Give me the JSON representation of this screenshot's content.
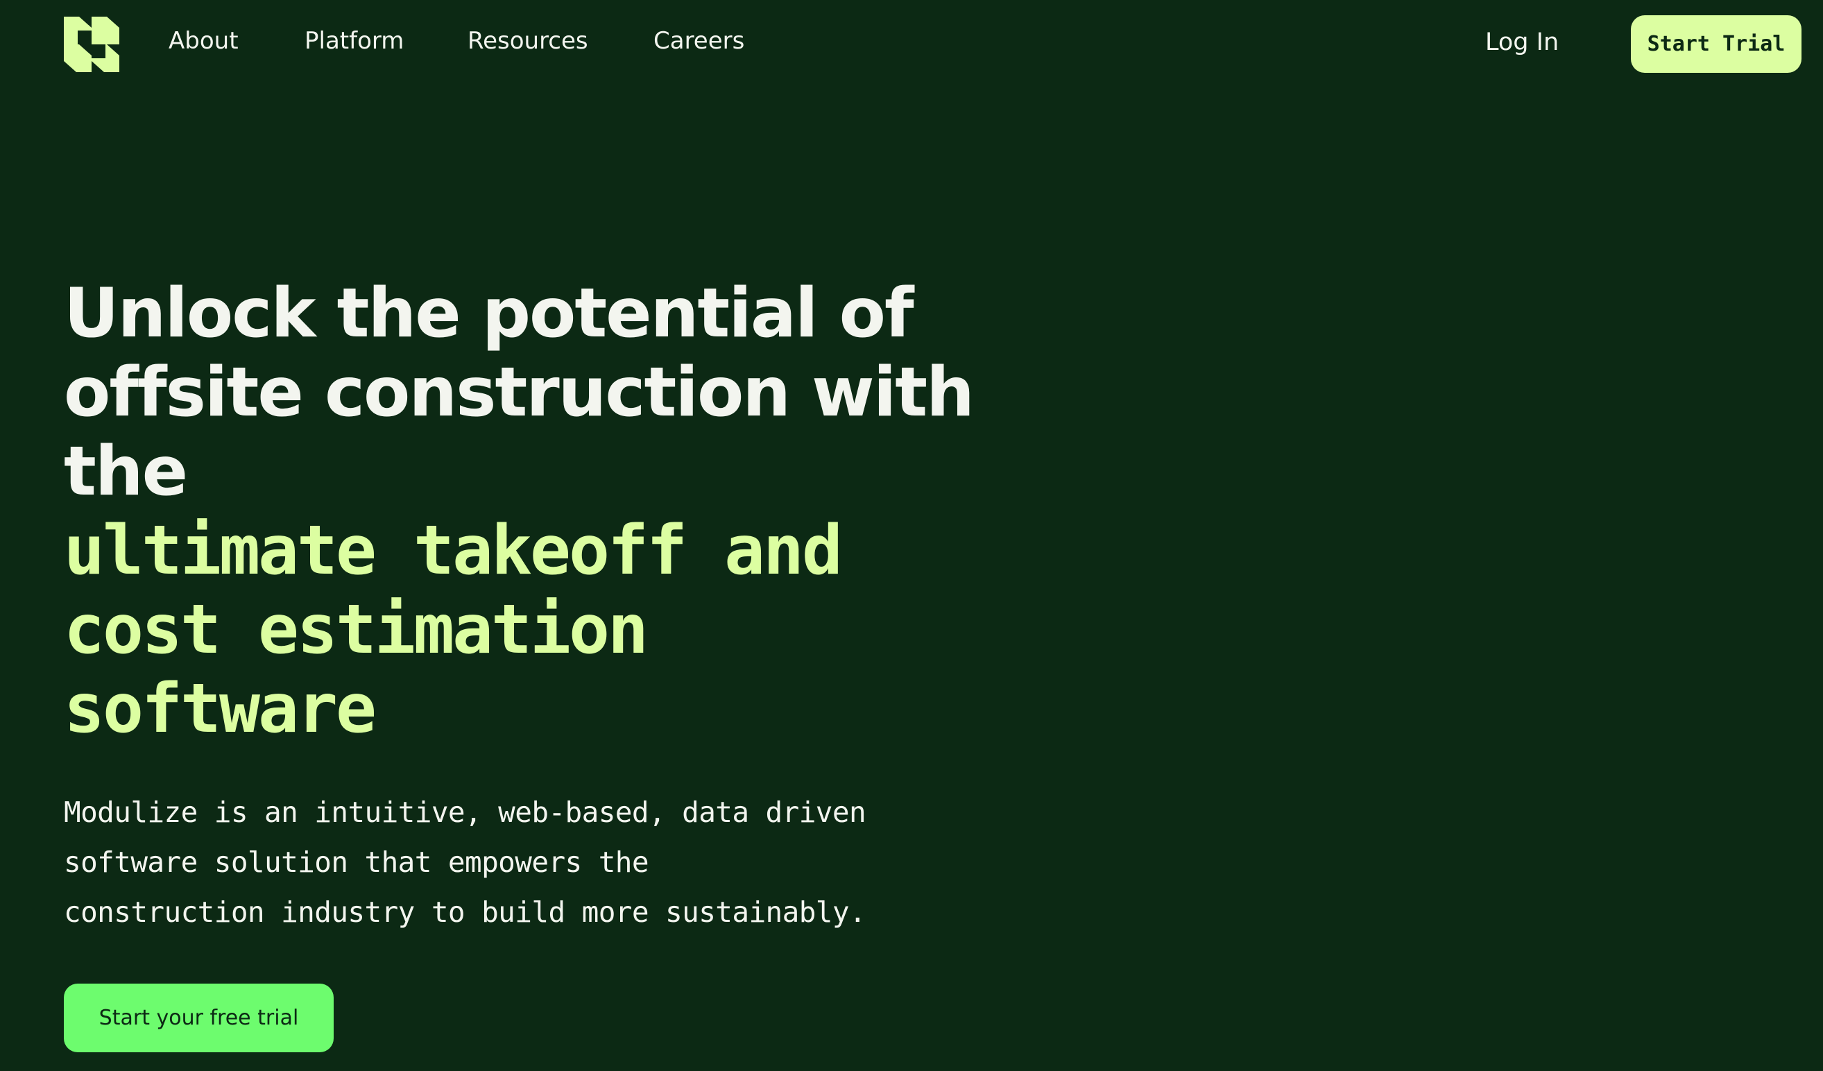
{
  "nav": {
    "logo_icon": "modulize-logo-icon",
    "links": [
      {
        "label": "About"
      },
      {
        "label": "Platform"
      },
      {
        "label": "Resources"
      },
      {
        "label": "Careers"
      }
    ],
    "login_label": "Log In",
    "trial_label": "Start Trial"
  },
  "hero": {
    "headline_lines": [
      "Unlock the potential of",
      "offsite construction with",
      "the"
    ],
    "accent_lines": [
      "ultimate takeoff and",
      "cost estimation",
      "software"
    ],
    "description_lines": [
      "Modulize is an intuitive, web-based, data driven",
      "software solution that empowers the",
      "construction industry to build more sustainably."
    ],
    "cta_label": "Start your free trial"
  },
  "colors": {
    "background": "#0c2914",
    "text": "#f3f5ef",
    "accent": "#dcfea1",
    "cta": "#6dfc6e"
  }
}
